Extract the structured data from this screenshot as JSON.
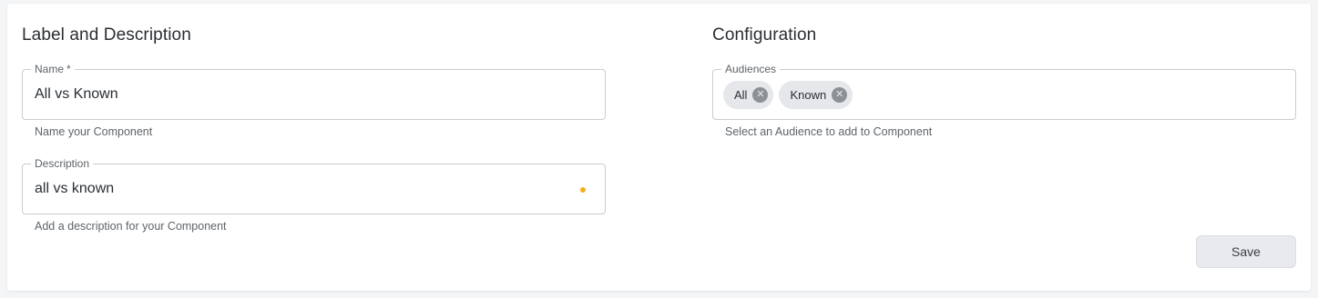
{
  "left_section": {
    "title": "Label and Description",
    "name_field": {
      "label": "Name",
      "required_marker": "*",
      "value": "All vs Known",
      "helper": "Name your Component"
    },
    "description_field": {
      "label": "Description",
      "value": "all vs known",
      "helper": "Add a description for your Component",
      "indicator_color": "#f2b01e"
    }
  },
  "right_section": {
    "title": "Configuration",
    "audiences_field": {
      "label": "Audiences",
      "chips": [
        {
          "label": "All",
          "remove_icon": "close-circle-icon"
        },
        {
          "label": "Known",
          "remove_icon": "close-circle-icon"
        }
      ],
      "helper": "Select an Audience to add to Component"
    }
  },
  "actions": {
    "save_label": "Save"
  }
}
